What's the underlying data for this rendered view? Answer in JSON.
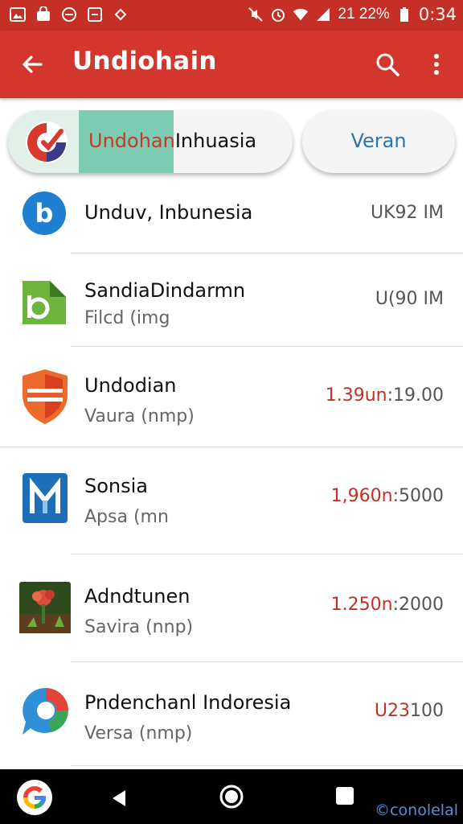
{
  "status_bar": {
    "time": "0:34",
    "battery": "21 22%",
    "icons": [
      "photo-icon",
      "bag-icon",
      "minus-circle-icon",
      "download-icon",
      "gps-icon",
      "mute-icon",
      "alarm-icon",
      "wifi-icon",
      "signal-icon",
      "battery-icon"
    ]
  },
  "app_bar": {
    "title": "Undiohain",
    "back_icon": "arrow-back-icon",
    "search_icon": "search-icon",
    "more_icon": "more-vert-icon"
  },
  "chips": {
    "main": {
      "highlight": "Undohan",
      "rest": "Inhuasia"
    },
    "second": {
      "label": "Veran"
    }
  },
  "list": [
    {
      "title": "Unduv, Inbunesia",
      "subtitle": "",
      "meta": "UK92 IM",
      "meta_red": "",
      "icon": "b-circle-icon"
    },
    {
      "title": "SandiaDindarmn",
      "subtitle": "Filcd (img",
      "meta": "U(90 IM",
      "meta_red": "",
      "icon": "green-file-icon"
    },
    {
      "title": "Undodian",
      "subtitle": "Vaura (nmp)",
      "meta": ":19.00",
      "meta_red": "1.39un",
      "icon": "shield-icon"
    },
    {
      "title": "Sonsia",
      "subtitle": "Apsa (mn",
      "meta": ":5000",
      "meta_red": "1,960n",
      "icon": "blue-square-icon"
    },
    {
      "title": "Adndtunen",
      "subtitle": "Savira (nnp)",
      "meta": ":2000",
      "meta_red": "1.250n",
      "icon": "game-thumbnail-icon"
    },
    {
      "title": "Pndenchanl Indoresia",
      "subtitle": "Versa (nmp)",
      "meta": "100",
      "meta_red": "U23",
      "icon": "chat-bubble-icon"
    }
  ],
  "nav_bar": {
    "watermark": "©conolelal",
    "icons": [
      "google-icon",
      "nav-back-icon",
      "nav-home-icon",
      "nav-recent-icon"
    ]
  },
  "colors": {
    "app_bar": "#d3362d",
    "status_bar": "#c62f26",
    "accent_red": "#c62f26",
    "chip_highlight": "#7ccbb2",
    "chip_secondary_text": "#2a73b6"
  }
}
